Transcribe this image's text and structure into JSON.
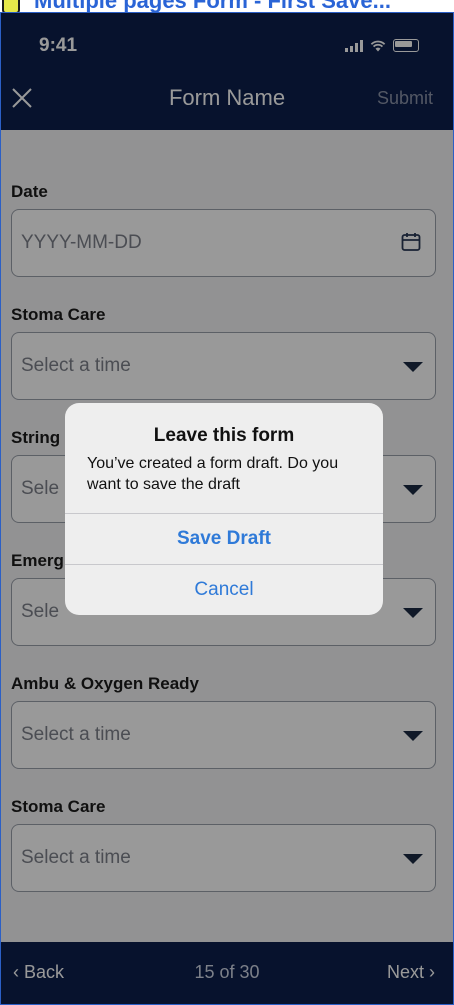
{
  "caption": {
    "text": "Multiple pages Form - First Save..."
  },
  "status_bar": {
    "time": "9:41"
  },
  "header": {
    "title": "Form Name",
    "submit_label": "Submit"
  },
  "fields": [
    {
      "label": "Date",
      "placeholder": "YYYY-MM-DD",
      "control": "date"
    },
    {
      "label": "Stoma Care",
      "placeholder": "Select a time",
      "control": "select"
    },
    {
      "label": "String",
      "placeholder": "Sele",
      "control": "select"
    },
    {
      "label": "Emerg",
      "placeholder": "Sele",
      "control": "select"
    },
    {
      "label": "Ambu & Oxygen Ready",
      "placeholder": "Select a time",
      "control": "select"
    },
    {
      "label": "Stoma Care",
      "placeholder": "Select a time",
      "control": "select"
    }
  ],
  "footer": {
    "back_label": "Back",
    "page_indicator": "15 of 30",
    "next_label": "Next"
  },
  "dialog": {
    "title": "Leave this form",
    "message": "You’ve created a form draft. Do you want to save the draft",
    "primary_button": "Save Draft",
    "secondary_button": "Cancel"
  },
  "colors": {
    "navy": "#0c1f4b",
    "accent_blue": "#2f7ad8",
    "caption_blue": "#2a64d6"
  }
}
